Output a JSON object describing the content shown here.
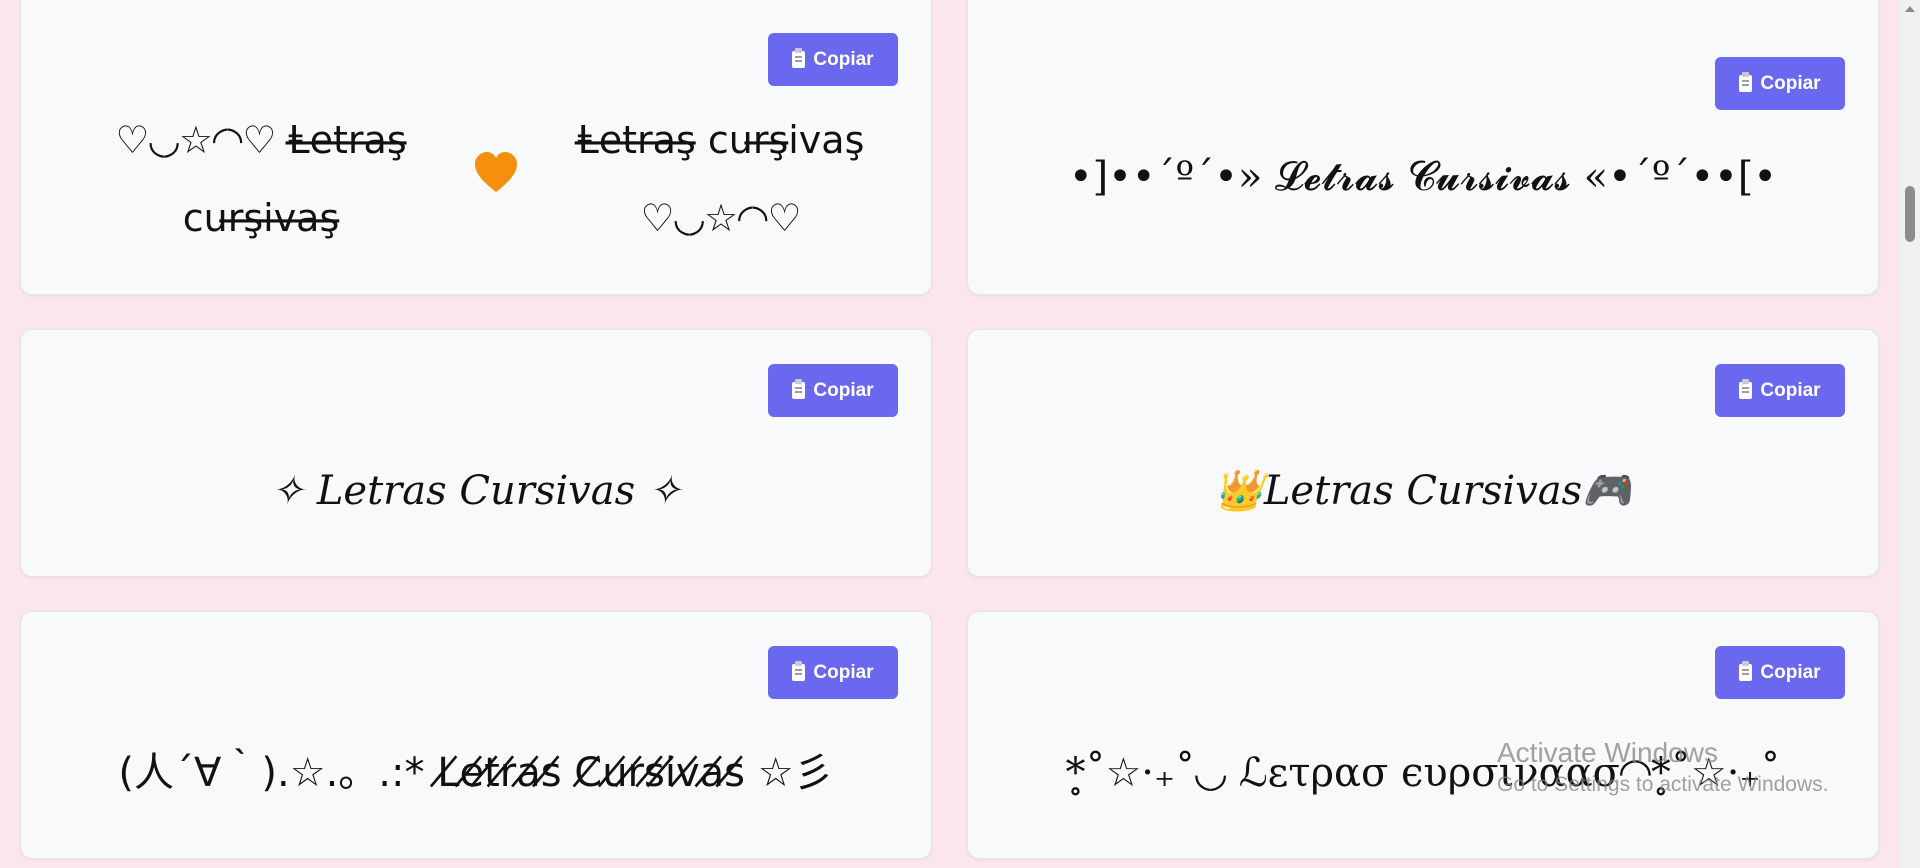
{
  "cards": [
    {
      "text_left": "♡◟◞☆◜◝♡ Ⱡ̶e̶t̶r̶a̶ş̶ cur̶ş̶i̶v̶a̶ş̶",
      "text_right": "Ⱡ̶e̶t̶r̶a̶ş̶ cur̶ş̶ivaş ♡◟◞☆◜◝♡",
      "separator": "orange-heart",
      "copy_label": "Copiar"
    },
    {
      "text": "•]••´º´•» 𝓛𝓮𝓽𝓻𝓪𝓼 𝓒𝓾𝓻𝓼𝓲𝓿𝓪𝓼 «•´º´••[•",
      "copy_label": "Copiar"
    },
    {
      "text": "✧ Letras Cursivas ✧",
      "copy_label": "Copiar"
    },
    {
      "text": "👑Letras Cursivas🎮",
      "copy_label": "Copiar"
    },
    {
      "text": "(人´∀｀).☆.。.:* L̸e̸t̸r̸a̸s̸ C̸u̸r̸s̸i̸v̸a̸s̸ ☆彡",
      "copy_label": "Copiar"
    },
    {
      "text": "*̥˚☆·₊˚◟◞ ℒετρασ ϵυρσιναασ◜◝*̥˚☆·₊˚",
      "copy_label": "Copiar"
    }
  ],
  "watermark": {
    "title": "Activate Windows",
    "subtitle": "Go to Settings to activate Windows."
  },
  "colors": {
    "background": "#fce6ee",
    "card": "#f8f9fb",
    "button": "#6a68ef"
  }
}
